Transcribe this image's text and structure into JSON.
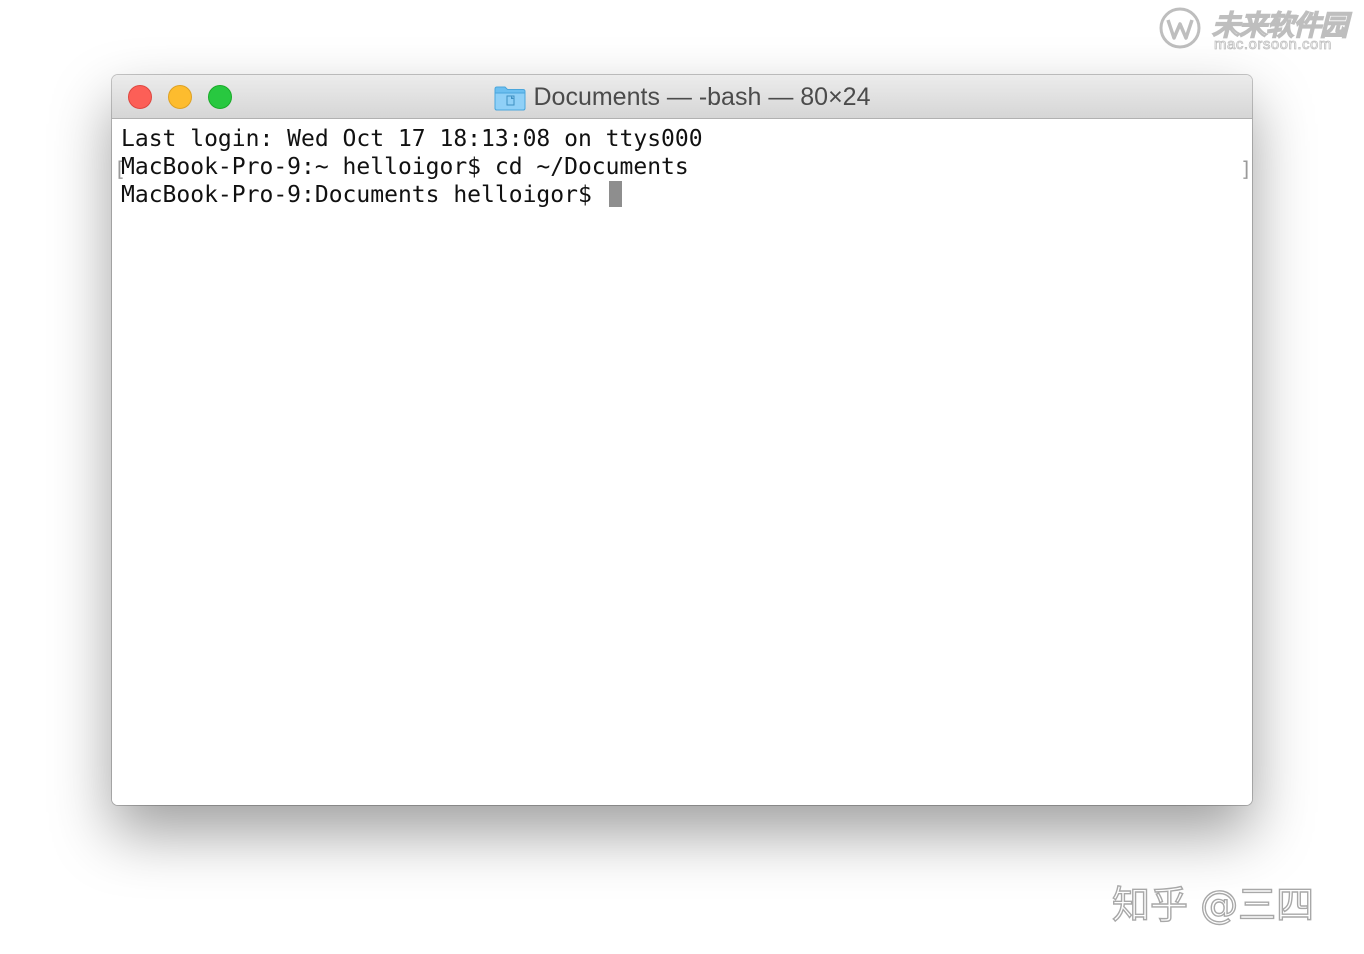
{
  "watermark": {
    "site_name": "未来软件园",
    "site_url": "mac.orsoon.com",
    "credit": "知乎 @三四"
  },
  "window": {
    "title": "Documents — -bash — 80×24",
    "controls": {
      "close_color": "#fc5f57",
      "minimize_color": "#fdbc2e",
      "zoom_color": "#28c840"
    },
    "terminal": {
      "lines": [
        "Last login: Wed Oct 17 18:13:08 on ttys000",
        "MacBook-Pro-9:~ helloigor$ cd ~/Documents",
        "MacBook-Pro-9:Documents helloigor$ "
      ],
      "mark_left": "[",
      "mark_right": "]"
    }
  }
}
